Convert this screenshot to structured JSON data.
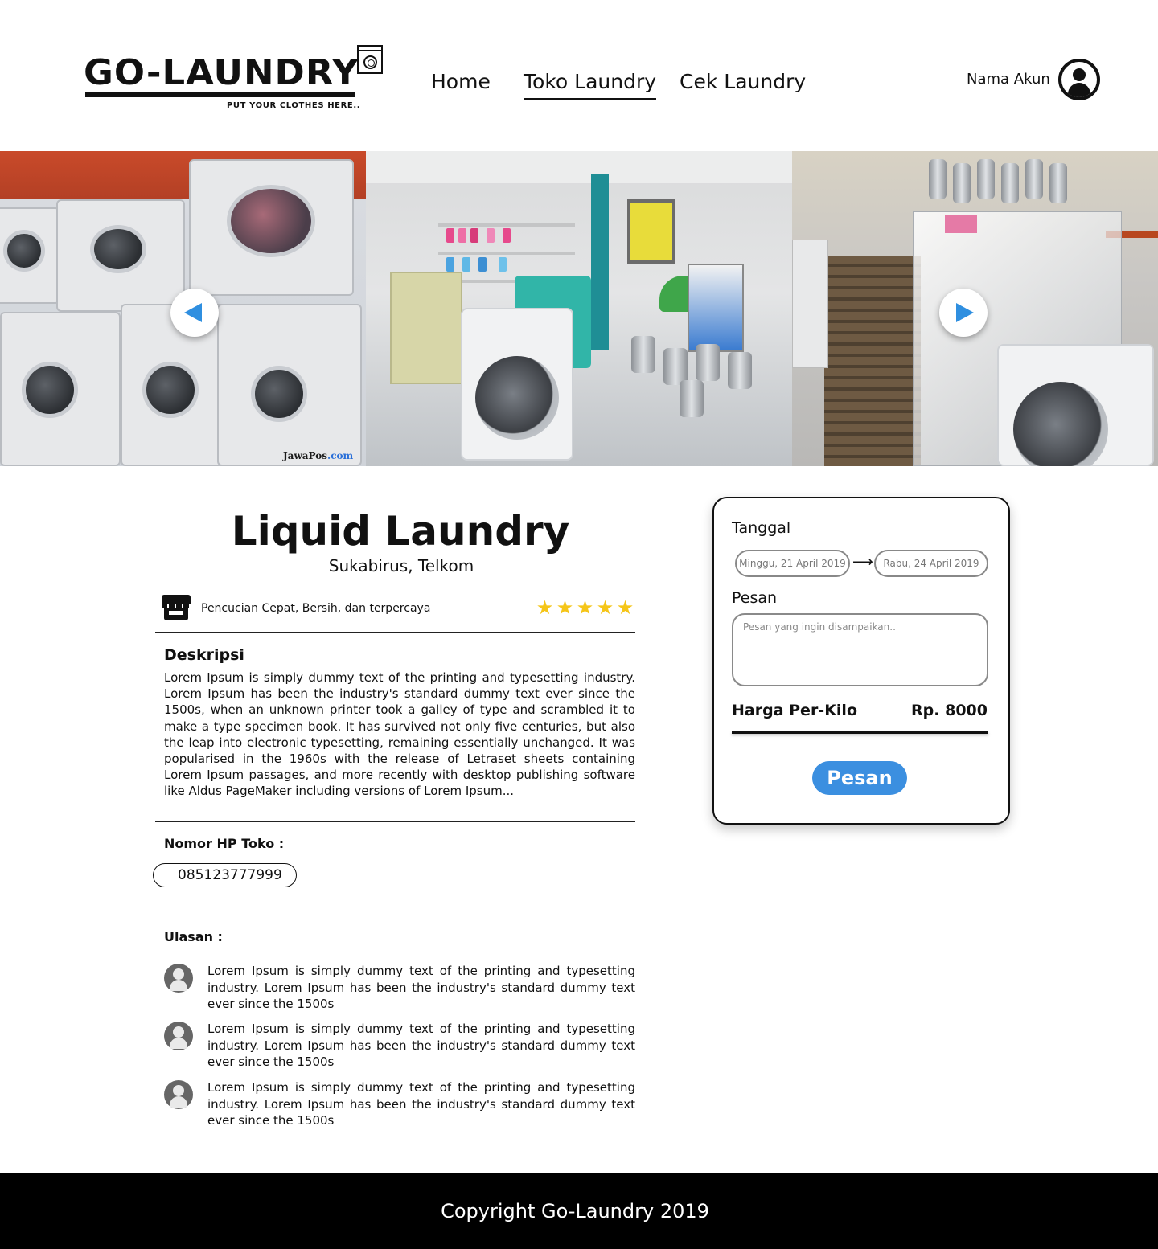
{
  "brand": {
    "name": "GO-LAUNDRY",
    "tagline": "PUT YOUR CLOTHES HERE.."
  },
  "nav": {
    "items": [
      {
        "label": "Home",
        "active": false
      },
      {
        "label": "Toko Laundry",
        "active": true
      },
      {
        "label": "Cek Laundry",
        "active": false
      }
    ]
  },
  "account": {
    "name": "Nama Akun"
  },
  "hero": {
    "watermark_main": "JawaPos",
    "watermark_suffix": ".com",
    "prev_icon": "chevron-left-icon",
    "next_icon": "chevron-right-icon"
  },
  "store": {
    "name": "Liquid Laundry",
    "location": "Sukabirus, Telkom",
    "tagline": "Pencucian Cepat, Bersih, dan terpercaya",
    "rating": 5,
    "rating_max": 5,
    "description_heading": "Deskripsi",
    "description": "Lorem Ipsum is simply dummy text of the printing and typesetting industry. Lorem Ipsum has been the industry's standard dummy text ever since the 1500s, when an unknown printer took a galley of type and scrambled it to make a type specimen book. It has survived not only five centuries, but also the leap into electronic typesetting, remaining essentially unchanged. It was popularised in the 1960s with the release of Letraset sheets containing Lorem Ipsum passages, and more recently with desktop publishing software like Aldus PageMaker including versions of Lorem Ipsum...",
    "phone_heading": "Nomor HP Toko :",
    "phone": "085123777999",
    "reviews_heading": "Ulasan :",
    "reviews": [
      {
        "text": "Lorem Ipsum is simply dummy text of the printing and typesetting industry. Lorem Ipsum has been the industry's standard dummy text ever since the 1500s"
      },
      {
        "text": "Lorem Ipsum is simply dummy text of the printing and typesetting industry. Lorem Ipsum has been the industry's standard dummy text ever since the 1500s"
      },
      {
        "text": "Lorem Ipsum is simply dummy text of the printing and typesetting industry. Lorem Ipsum has been the industry's standard dummy text ever since the 1500s"
      }
    ]
  },
  "booking": {
    "date_label": "Tanggal",
    "date_from": "Minggu, 21 April 2019",
    "date_arrow": "⟶",
    "date_to": "Rabu, 24 April 2019",
    "message_label": "Pesan",
    "message_placeholder": "Pesan yang ingin disampaikan..",
    "message_value": "",
    "price_label": "Harga Per-Kilo",
    "price_value": "Rp. 8000",
    "submit_label": "Pesan"
  },
  "footer": {
    "copyright": "Copyright Go-Laundry 2019"
  },
  "colors": {
    "accent": "#3b8fe0",
    "star": "#f5c518",
    "footer_bg": "#000000"
  }
}
